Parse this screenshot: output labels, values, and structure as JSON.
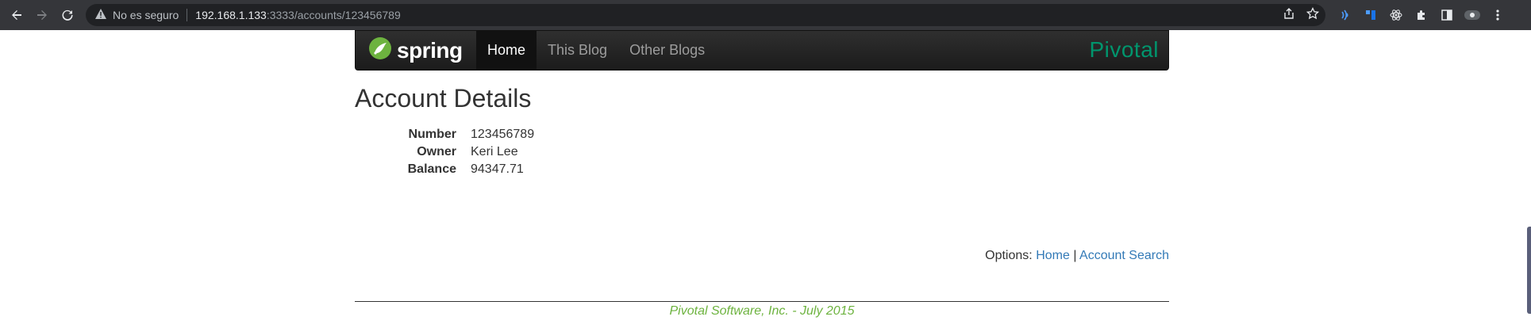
{
  "browser": {
    "security_text": "No es seguro",
    "url_host": "192.168.1.133",
    "url_rest": ":3333/accounts/123456789"
  },
  "navbar": {
    "brand": "spring",
    "links": [
      "Home",
      "This Blog",
      "Other Blogs"
    ],
    "right_logo": "Pivotal"
  },
  "page": {
    "title": "Account Details",
    "details": [
      {
        "label": "Number",
        "value": "123456789"
      },
      {
        "label": "Owner",
        "value": "Keri Lee"
      },
      {
        "label": "Balance",
        "value": "94347.71"
      }
    ],
    "options_label": "Options:",
    "options_links": [
      "Home",
      "Account Search"
    ],
    "options_sep": "|"
  },
  "footer": {
    "text": "Pivotal Software, Inc. - July 2015"
  },
  "colors": {
    "spring_green": "#6db33f",
    "pivotal_teal": "#00956d",
    "link_blue": "#337ab7"
  }
}
